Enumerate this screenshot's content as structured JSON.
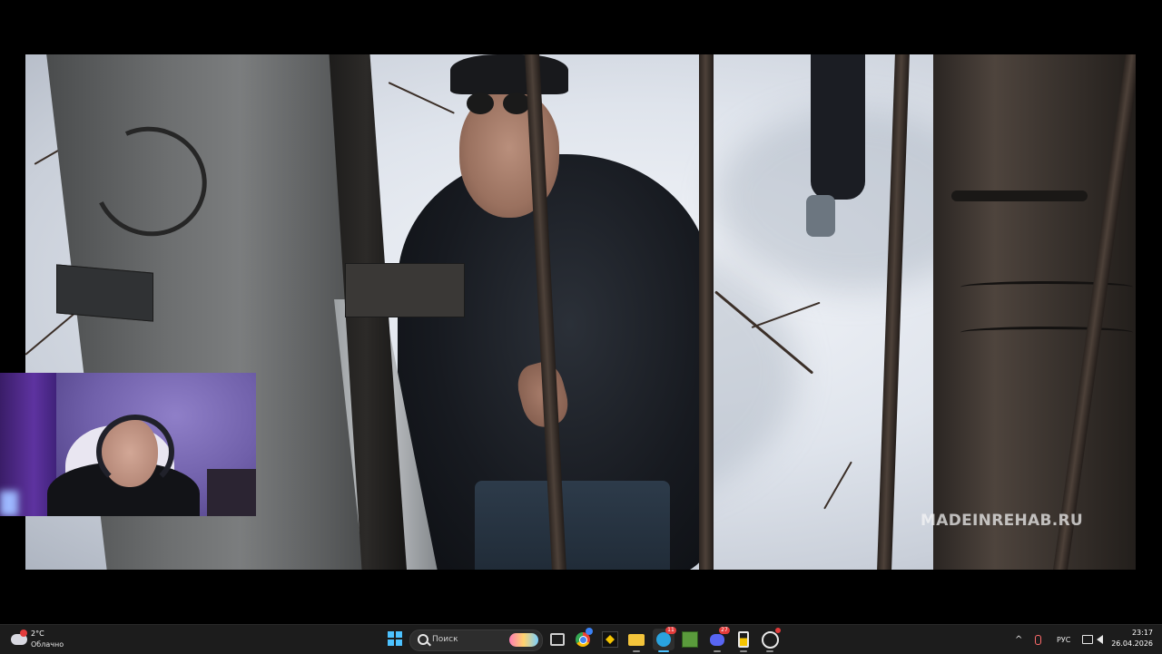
{
  "video": {
    "watermark": "MADEINREHAB.RU"
  },
  "webcam": {
    "label": "streamer-webcam"
  },
  "taskbar": {
    "weather": {
      "temperature": "2°C",
      "condition": "Облачно"
    },
    "search": {
      "placeholder": "Поиск"
    },
    "apps": [
      {
        "name": "task-view",
        "badge": ""
      },
      {
        "name": "chrome",
        "badge": ""
      },
      {
        "name": "app-yellow",
        "badge": ""
      },
      {
        "name": "file-explorer",
        "badge": ""
      },
      {
        "name": "telegram",
        "badge": "11"
      },
      {
        "name": "minecraft",
        "badge": ""
      },
      {
        "name": "discord",
        "badge": "27"
      },
      {
        "name": "app-battery",
        "badge": ""
      },
      {
        "name": "obs",
        "badge": ""
      }
    ],
    "tray": {
      "chevron": "^",
      "language": "РУС",
      "time": "23:17",
      "date": "26.04.2026"
    }
  }
}
